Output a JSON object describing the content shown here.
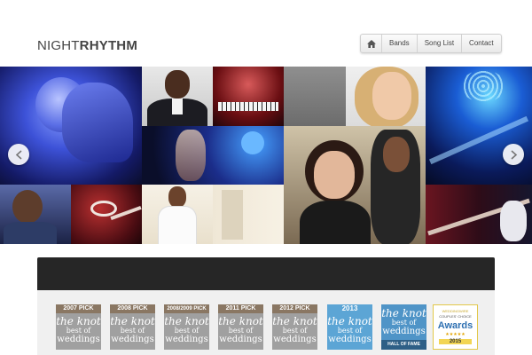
{
  "header": {
    "logo_light": "NIGHT",
    "logo_bold": "RHYTHM"
  },
  "nav": {
    "home_icon": "home-icon",
    "items": [
      {
        "label": "Bands"
      },
      {
        "label": "Song List"
      },
      {
        "label": "Contact"
      }
    ]
  },
  "slider": {
    "prev_icon": "chevron-left-icon",
    "next_icon": "chevron-right-icon"
  },
  "awards": [
    {
      "year": "2007 PICK",
      "line1": "the knot",
      "line2": "best of",
      "line3": "weddings"
    },
    {
      "year": "2008 PICK",
      "line1": "the knot",
      "line2": "best of",
      "line3": "weddings"
    },
    {
      "year": "2008/2009 PICK",
      "line1": "the knot",
      "line2": "best of",
      "line3": "weddings"
    },
    {
      "year": "2011 PICK",
      "line1": "the knot",
      "line2": "best of",
      "line3": "weddings"
    },
    {
      "year": "2012 PICK",
      "line1": "the knot",
      "line2": "best of",
      "line3": "weddings"
    },
    {
      "year": "2013",
      "line1": "the knot",
      "line2": "best of",
      "line3": "weddings"
    },
    {
      "line1": "the knot",
      "line2": "best of",
      "line3": "weddings",
      "hof": "HALL OF FAME"
    },
    {
      "top": "WEDDINGWIRE",
      "sub": "COUPLES' CHOICE",
      "title": "Awards",
      "stars": "★★★★★",
      "year": "2015"
    }
  ],
  "colors": {
    "awards_bar": "#262626",
    "badge_gray": "#a0a0a0",
    "badge_blue": "#5ca5d5"
  }
}
